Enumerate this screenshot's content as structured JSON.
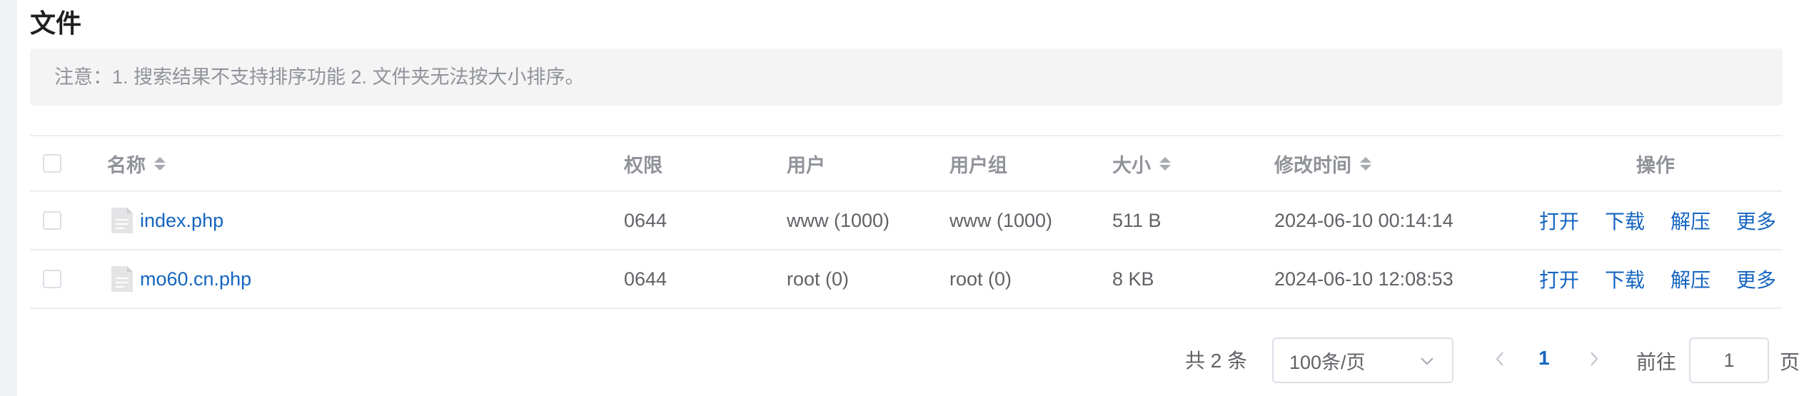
{
  "section_title": "文件",
  "notice": "注意：1. 搜索结果不支持排序功能 2. 文件夹无法按大小排序。",
  "table": {
    "headers": {
      "name": "名称",
      "permission": "权限",
      "user": "用户",
      "group": "用户组",
      "size": "大小",
      "modified": "修改时间",
      "actions": "操作"
    },
    "rows": [
      {
        "name": "index.php",
        "permission": "0644",
        "user": "www (1000)",
        "group": "www (1000)",
        "size": "511 B",
        "modified": "2024-06-10 00:14:14"
      },
      {
        "name": "mo60.cn.php",
        "permission": "0644",
        "user": "root (0)",
        "group": "root (0)",
        "size": "8 KB",
        "modified": "2024-06-10 12:08:53"
      }
    ],
    "actions": {
      "open": "打开",
      "download": "下载",
      "extract": "解压",
      "more": "更多"
    }
  },
  "pagination": {
    "total": "共 2 条",
    "page_size": "100条/页",
    "current_page": "1",
    "goto_label": "前往",
    "goto_value": "1",
    "goto_suffix": "页"
  },
  "icons": {
    "file": "file-icon",
    "sort": "sort-caret-icon",
    "dropdown": "chevron-down-icon",
    "prev": "chevron-left-icon",
    "next": "chevron-right-icon"
  },
  "colors": {
    "link": "#1565c0",
    "header_text": "#909399",
    "notice_bg": "#f4f4f5",
    "border": "#ebeef5"
  }
}
